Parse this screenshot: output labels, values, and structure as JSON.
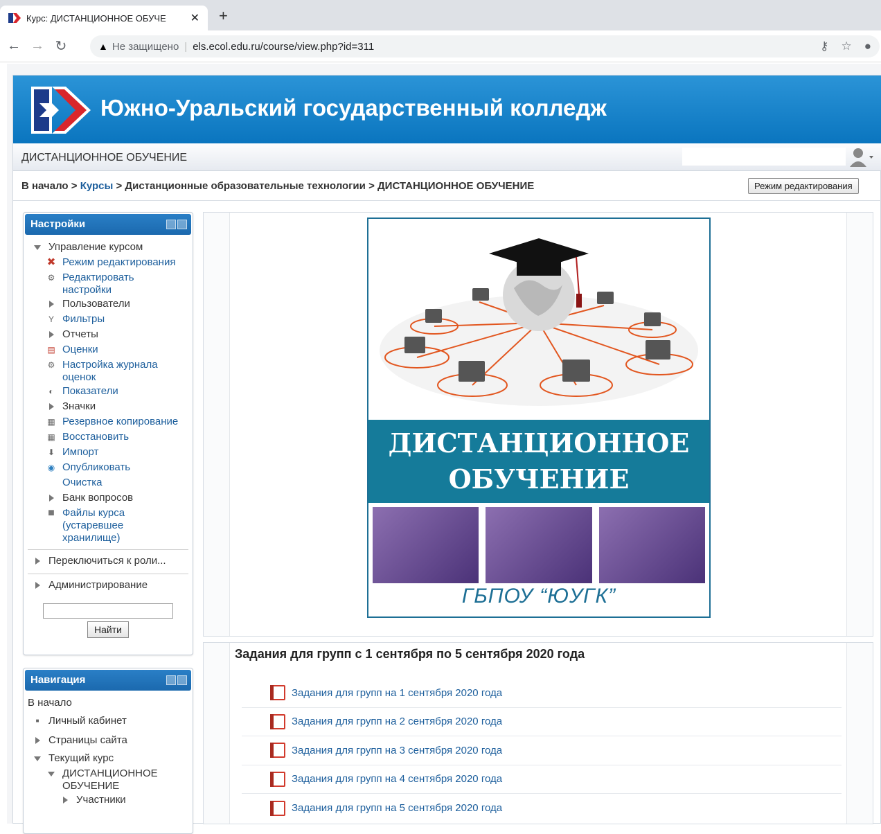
{
  "browser": {
    "tab_title": "Курс: ДИСТАНЦИОННОЕ ОБУЧЕ",
    "security_label": "Не защищено",
    "url": "els.ecol.edu.ru/course/view.php?id=311"
  },
  "site": {
    "title": "Южно-Уральский государственный колледж",
    "course_short": "ДИСТАНЦИОННОЕ ОБУЧЕНИЕ"
  },
  "breadcrumb": {
    "home": "В начало",
    "courses": "Курсы",
    "category": "Дистанционные образовательные технологии",
    "current": "ДИСТАНЦИОННОЕ ОБУЧЕНИЕ",
    "sep": ">"
  },
  "edit_mode_button": "Режим редактирования",
  "settings_block": {
    "title": "Настройки",
    "course_admin": "Управление курсом",
    "items": [
      {
        "label": "Режим редактирования",
        "icon": "tools-icon"
      },
      {
        "label": "Редактировать настройки",
        "icon": "gear-icon"
      },
      {
        "label": "Пользователи",
        "icon": "expand-arrow-icon"
      },
      {
        "label": "Фильтры",
        "icon": "filter-icon"
      },
      {
        "label": "Отчеты",
        "icon": "expand-arrow-icon"
      },
      {
        "label": "Оценки",
        "icon": "grades-icon"
      },
      {
        "label": "Настройка журнала оценок",
        "icon": "gear-icon"
      },
      {
        "label": "Показатели",
        "icon": "outcomes-icon"
      },
      {
        "label": "Значки",
        "icon": "expand-arrow-icon"
      },
      {
        "label": "Резервное копирование",
        "icon": "backup-icon"
      },
      {
        "label": "Восстановить",
        "icon": "restore-icon"
      },
      {
        "label": "Импорт",
        "icon": "import-icon"
      },
      {
        "label": "Опубликовать",
        "icon": "publish-icon"
      },
      {
        "label": "Очистка",
        "icon": ""
      },
      {
        "label": "Банк вопросов",
        "icon": "expand-arrow-icon"
      },
      {
        "label": "Файлы курса (устаревшее хранилище)",
        "icon": "folder-icon"
      }
    ],
    "switch_role": "Переключиться к роли...",
    "admin": "Администрирование",
    "search_button": "Найти"
  },
  "nav_block": {
    "title": "Навигация",
    "home": "В начало",
    "dashboard": "Личный кабинет",
    "site_pages": "Страницы сайта",
    "current_course": "Текущий курс",
    "course": "ДИСТАНЦИОННОЕ ОБУЧЕНИЕ",
    "participants": "Участники"
  },
  "poster": {
    "line1": "ДИСТАНЦИОННОЕ",
    "line2": "ОБУЧЕНИЕ",
    "signature": "ГБПОУ “ЮУГК”"
  },
  "section2": {
    "title": "Задания для групп с 1 сентября по 5 сентября 2020 года",
    "activities": [
      "Задания для групп на 1 сентября 2020 года",
      "Задания для групп на 2 сентября 2020 года",
      "Задания для групп на 3 сентября 2020 года",
      "Задания для групп на 4 сентября 2020 года",
      "Задания для групп на 5 сентября 2020 года"
    ]
  },
  "colors": {
    "banner": "#0a75bf",
    "link": "#1c5e9c",
    "poster_band": "#157b9a"
  }
}
